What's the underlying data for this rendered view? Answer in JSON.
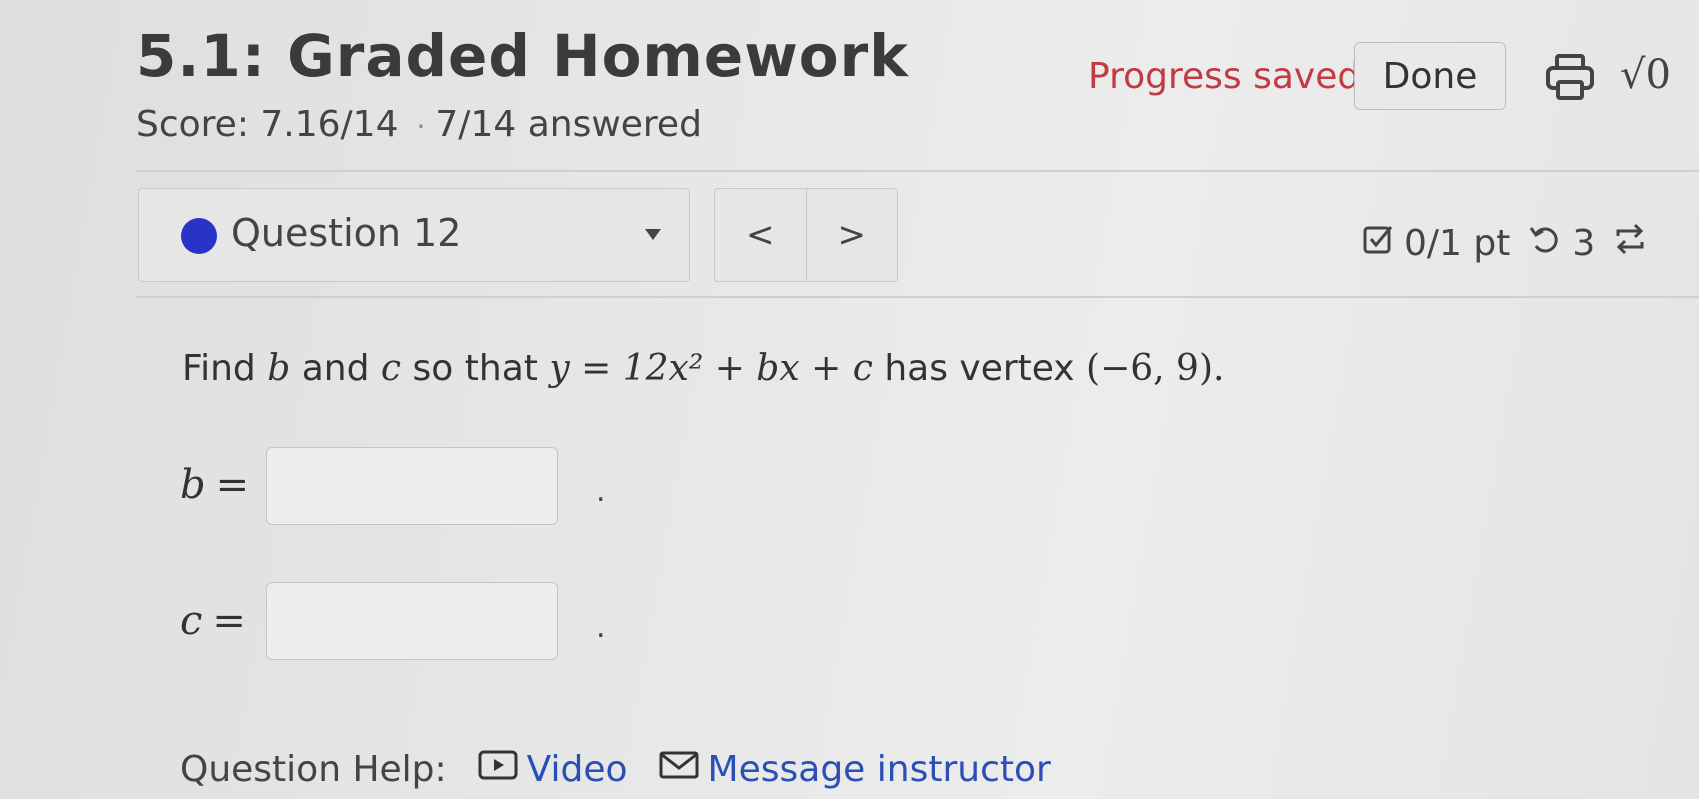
{
  "header": {
    "title": "5.1: Graded Homework",
    "score": "Score: 7.16/14",
    "answered": "7/14 answered",
    "progress_status": "Progress saved",
    "done_label": "Done",
    "print_icon": "print-icon",
    "math_icon_label": "√0"
  },
  "question_nav": {
    "selected_question": "Question 12",
    "prev_label": "<",
    "next_label": ">",
    "status_dot_color": "#2833c8"
  },
  "status_bar": {
    "points": "0/1 pt",
    "attempts": "3"
  },
  "problem": {
    "text_find": "Find",
    "var_b": "b",
    "text_and": "and",
    "var_c": "c",
    "text_so_that": "so that",
    "equation": "y = 12x² + bx + c",
    "text_has_vertex": "has vertex",
    "vertex": "(−6, 9)."
  },
  "answers": [
    {
      "label": "b",
      "value": "",
      "suffix": "."
    },
    {
      "label": "c",
      "value": "",
      "suffix": "."
    }
  ],
  "help": {
    "label": "Question Help:",
    "video_label": "Video",
    "message_label": "Message instructor"
  },
  "colors": {
    "progress_text": "#c23a44",
    "link": "#2a4fb5"
  }
}
